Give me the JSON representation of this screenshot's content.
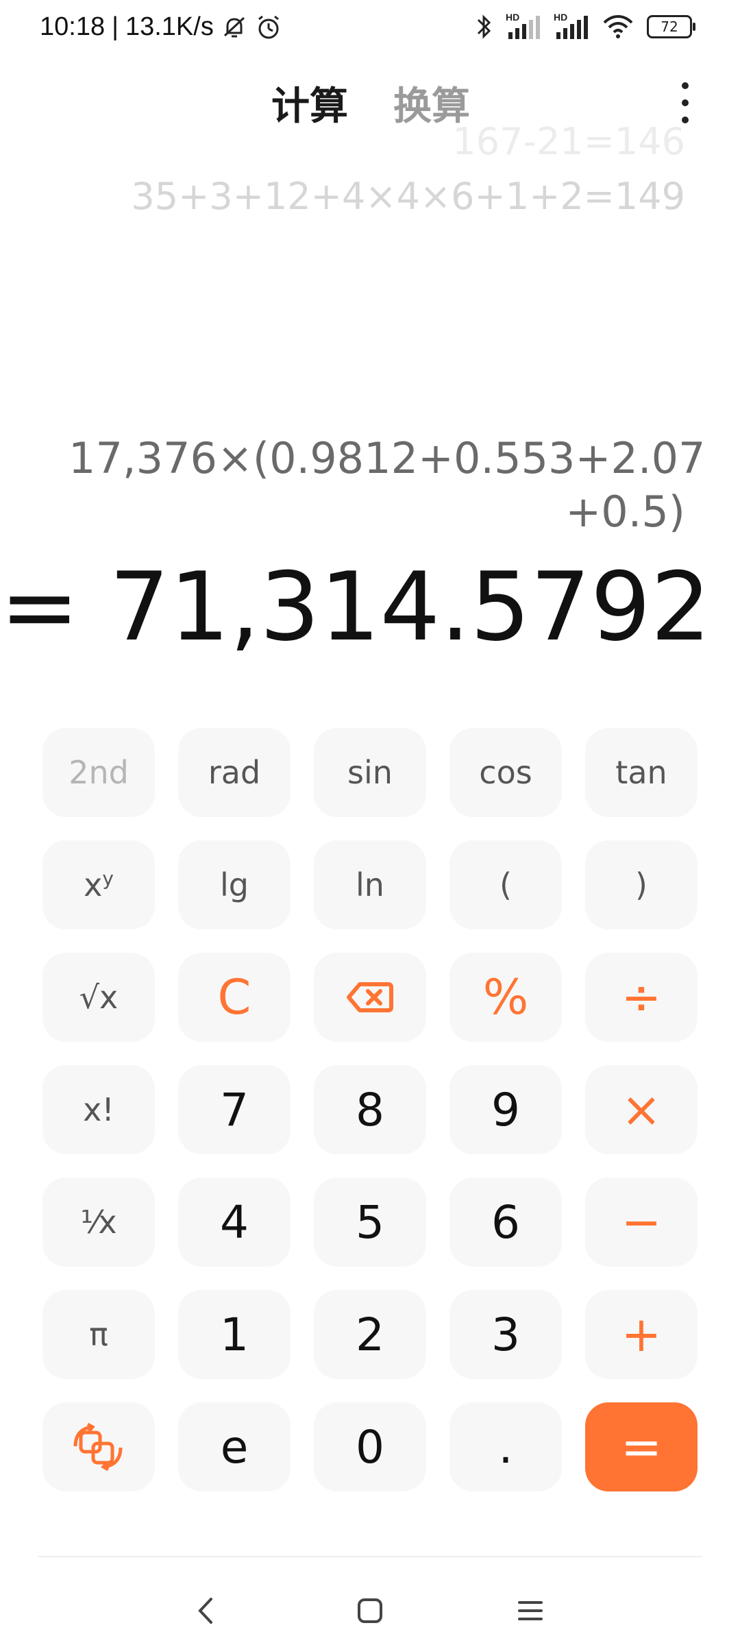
{
  "status_bar": {
    "time": "10:18",
    "separator": "|",
    "speed": "13.1K/s",
    "battery": "72",
    "signal_label_1": "HD",
    "signal_label_2": "HD"
  },
  "header": {
    "tab_calc": "计算",
    "tab_convert": "换算"
  },
  "history": {
    "line_faded": "167-21=146",
    "line_recent": "35+3+12+4×4×6+1+2=149"
  },
  "display": {
    "expression_line1": "17,376×(0.9812+0.553+2.07",
    "expression_line2": "+0.5)",
    "result": "= 71,314.5792"
  },
  "keys": {
    "second": "2nd",
    "rad": "rad",
    "sin": "sin",
    "cos": "cos",
    "tan": "tan",
    "pow_base": "x",
    "pow_exp": "y",
    "lg": "lg",
    "ln": "ln",
    "lparen": "(",
    "rparen": ")",
    "sqrt": "√x",
    "clear": "C",
    "percent": "%",
    "divide": "÷",
    "factorial": "x!",
    "seven": "7",
    "eight": "8",
    "nine": "9",
    "multiply": "×",
    "reciprocal": "¹⁄x",
    "four": "4",
    "five": "5",
    "six": "6",
    "minus": "−",
    "pi": "π",
    "one": "1",
    "two": "2",
    "three": "3",
    "plus": "+",
    "e": "e",
    "zero": "0",
    "dot": ".",
    "equals": "="
  },
  "colors": {
    "accent": "#ff7433",
    "key_bg": "#f7f7f7"
  },
  "icons": {
    "backspace": "backspace-icon",
    "switch_mode": "switch-mode-icon",
    "more": "more-vertical-icon",
    "nav_back": "back-icon",
    "nav_home": "home-icon",
    "nav_menu": "menu-icon"
  }
}
